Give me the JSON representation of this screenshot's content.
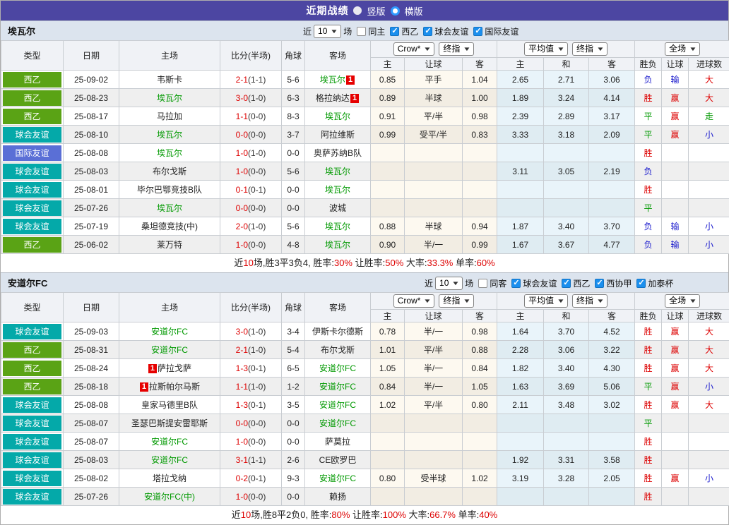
{
  "titlebar": {
    "title": "近期战绩",
    "radios": [
      {
        "label": "竖版",
        "checked": false
      },
      {
        "label": "横版",
        "checked": true
      }
    ]
  },
  "columns": [
    "类型",
    "日期",
    "主场",
    "比分(半场)",
    "角球",
    "客场",
    "主",
    "让球",
    "客",
    "主",
    "和",
    "客",
    "胜负",
    "让球",
    "进球数"
  ],
  "dropdowns": {
    "count": "10",
    "crow": "Crow*",
    "final_a": "终指",
    "avg": "平均值",
    "final_b": "终指",
    "full": "全场"
  },
  "filter_words": {
    "near": "近",
    "matches": "场"
  },
  "colors": {
    "accent_purple": "#4c46a2",
    "league_green": "#5aa315",
    "club_friendly_teal": "#04a9a9",
    "intl_friendly_blue": "#5a6fd6",
    "team_green": "#009900",
    "win_red": "#dd0000",
    "draw_green": "#009900",
    "loss_blue": "#1a1acd",
    "badge_red": "#e60000"
  },
  "sections": [
    {
      "team": "埃瓦尔",
      "checkboxes": [
        {
          "label": "同主",
          "checked": false
        },
        {
          "label": "西乙",
          "checked": true
        },
        {
          "label": "球会友谊",
          "checked": true
        },
        {
          "label": "国际友谊",
          "checked": true
        }
      ],
      "rows": [
        {
          "type": "西乙",
          "tc": "liga",
          "date": "25-09-02",
          "home": {
            "n": "韦斯卡"
          },
          "ft": "2-1",
          "ht": "(1-1)",
          "corner": "5-6",
          "away": {
            "n": "埃瓦尔",
            "g": 1,
            "badge": "1",
            "bpos": "after"
          },
          "crow": [
            "0.85",
            "平手",
            "1.04"
          ],
          "avg": [
            "2.65",
            "2.71",
            "3.06"
          ],
          "res": [
            [
              "负",
              "b"
            ],
            [
              "输",
              "b"
            ],
            [
              "大",
              "r"
            ]
          ]
        },
        {
          "type": "西乙",
          "tc": "liga",
          "date": "25-08-23",
          "home": {
            "n": "埃瓦尔",
            "g": 1
          },
          "ft": "3-0",
          "ht": "(1-0)",
          "corner": "6-3",
          "away": {
            "n": "格拉纳达",
            "badge": "1",
            "bpos": "after"
          },
          "crow": [
            "0.89",
            "半球",
            "1.00"
          ],
          "avg": [
            "1.89",
            "3.24",
            "4.14"
          ],
          "res": [
            [
              "胜",
              "r"
            ],
            [
              "赢",
              "r"
            ],
            [
              "大",
              "r"
            ]
          ]
        },
        {
          "type": "西乙",
          "tc": "liga",
          "date": "25-08-17",
          "home": {
            "n": "马拉加"
          },
          "ft": "1-1",
          "ht": "(0-0)",
          "corner": "8-3",
          "away": {
            "n": "埃瓦尔",
            "g": 1
          },
          "crow": [
            "0.91",
            "平/半",
            "0.98"
          ],
          "avg": [
            "2.39",
            "2.89",
            "3.17"
          ],
          "res": [
            [
              "平",
              "g"
            ],
            [
              "赢",
              "r"
            ],
            [
              "走",
              "g"
            ]
          ]
        },
        {
          "type": "球会友谊",
          "tc": "club",
          "date": "25-08-10",
          "home": {
            "n": "埃瓦尔",
            "g": 1
          },
          "ft": "0-0",
          "ht": "(0-0)",
          "corner": "3-7",
          "away": {
            "n": "阿拉维斯"
          },
          "crow": [
            "0.99",
            "受平/半",
            "0.83"
          ],
          "avg": [
            "3.33",
            "3.18",
            "2.09"
          ],
          "res": [
            [
              "平",
              "g"
            ],
            [
              "赢",
              "r"
            ],
            [
              "小",
              "b"
            ]
          ]
        },
        {
          "type": "国际友谊",
          "tc": "intl",
          "date": "25-08-08",
          "home": {
            "n": "埃瓦尔",
            "g": 1
          },
          "ft": "1-0",
          "ht": "(1-0)",
          "corner": "0-0",
          "away": {
            "n": "奥萨苏纳B队"
          },
          "crow": [
            "",
            "",
            ""
          ],
          "avg": [
            "",
            "",
            ""
          ],
          "res": [
            [
              "胜",
              "r"
            ],
            [
              "",
              ""
            ],
            [
              "",
              ""
            ]
          ]
        },
        {
          "type": "球会友谊",
          "tc": "club",
          "date": "25-08-03",
          "home": {
            "n": "布尔戈斯"
          },
          "ft": "1-0",
          "ht": "(0-0)",
          "corner": "5-6",
          "away": {
            "n": "埃瓦尔",
            "g": 1
          },
          "crow": [
            "",
            "",
            ""
          ],
          "avg": [
            "3.11",
            "3.05",
            "2.19"
          ],
          "res": [
            [
              "负",
              "b"
            ],
            [
              "",
              ""
            ],
            [
              "",
              ""
            ]
          ]
        },
        {
          "type": "球会友谊",
          "tc": "club",
          "date": "25-08-01",
          "home": {
            "n": "毕尔巴鄂竞技B队"
          },
          "ft": "0-1",
          "ht": "(0-1)",
          "corner": "0-0",
          "away": {
            "n": "埃瓦尔",
            "g": 1
          },
          "crow": [
            "",
            "",
            ""
          ],
          "avg": [
            "",
            "",
            ""
          ],
          "res": [
            [
              "胜",
              "r"
            ],
            [
              "",
              ""
            ],
            [
              "",
              ""
            ]
          ]
        },
        {
          "type": "球会友谊",
          "tc": "club",
          "date": "25-07-26",
          "home": {
            "n": "埃瓦尔",
            "g": 1
          },
          "ft": "0-0",
          "ht": "(0-0)",
          "corner": "0-0",
          "away": {
            "n": "波城"
          },
          "crow": [
            "",
            "",
            ""
          ],
          "avg": [
            "",
            "",
            ""
          ],
          "res": [
            [
              "平",
              "g"
            ],
            [
              "",
              ""
            ],
            [
              "",
              ""
            ]
          ]
        },
        {
          "type": "球会友谊",
          "tc": "club",
          "date": "25-07-19",
          "home": {
            "n": "桑坦德竞技(中)"
          },
          "ft": "2-0",
          "ht": "(1-0)",
          "corner": "5-6",
          "away": {
            "n": "埃瓦尔",
            "g": 1
          },
          "crow": [
            "0.88",
            "半球",
            "0.94"
          ],
          "avg": [
            "1.87",
            "3.40",
            "3.70"
          ],
          "res": [
            [
              "负",
              "b"
            ],
            [
              "输",
              "b"
            ],
            [
              "小",
              "b"
            ]
          ]
        },
        {
          "type": "西乙",
          "tc": "liga",
          "date": "25-06-02",
          "home": {
            "n": "莱万特"
          },
          "ft": "1-0",
          "ht": "(0-0)",
          "corner": "4-8",
          "away": {
            "n": "埃瓦尔",
            "g": 1
          },
          "crow": [
            "0.90",
            "半/一",
            "0.99"
          ],
          "avg": [
            "1.67",
            "3.67",
            "4.77"
          ],
          "res": [
            [
              "负",
              "b"
            ],
            [
              "输",
              "b"
            ],
            [
              "小",
              "b"
            ]
          ]
        }
      ],
      "summary": [
        [
          "近",
          0
        ],
        [
          "10",
          1
        ],
        [
          "场,胜3平3负4, 胜率:",
          0
        ],
        [
          "30%",
          1
        ],
        [
          " 让胜率:",
          0
        ],
        [
          "50%",
          1
        ],
        [
          " 大率:",
          0
        ],
        [
          "33.3%",
          1
        ],
        [
          " 单率:",
          0
        ],
        [
          "60%",
          1
        ]
      ]
    },
    {
      "team": "安道尔FC",
      "checkboxes": [
        {
          "label": "同客",
          "checked": false
        },
        {
          "label": "球会友谊",
          "checked": true
        },
        {
          "label": "西乙",
          "checked": true
        },
        {
          "label": "西协甲",
          "checked": true
        },
        {
          "label": "加泰杯",
          "checked": true
        }
      ],
      "rows": [
        {
          "type": "球会友谊",
          "tc": "club",
          "date": "25-09-03",
          "home": {
            "n": "安道尔FC",
            "g": 1
          },
          "ft": "3-0",
          "ht": "(1-0)",
          "corner": "3-4",
          "away": {
            "n": "伊斯卡尔德斯"
          },
          "crow": [
            "0.78",
            "半/一",
            "0.98"
          ],
          "avg": [
            "1.64",
            "3.70",
            "4.52"
          ],
          "res": [
            [
              "胜",
              "r"
            ],
            [
              "赢",
              "r"
            ],
            [
              "大",
              "r"
            ]
          ]
        },
        {
          "type": "西乙",
          "tc": "liga",
          "date": "25-08-31",
          "home": {
            "n": "安道尔FC",
            "g": 1
          },
          "ft": "2-1",
          "ht": "(1-0)",
          "corner": "5-4",
          "away": {
            "n": "布尔戈斯"
          },
          "crow": [
            "1.01",
            "平/半",
            "0.88"
          ],
          "avg": [
            "2.28",
            "3.06",
            "3.22"
          ],
          "res": [
            [
              "胜",
              "r"
            ],
            [
              "赢",
              "r"
            ],
            [
              "大",
              "r"
            ]
          ]
        },
        {
          "type": "西乙",
          "tc": "liga",
          "date": "25-08-24",
          "home": {
            "n": "萨拉戈萨",
            "badge": "1",
            "bpos": "before"
          },
          "ft": "1-3",
          "ht": "(0-1)",
          "corner": "6-5",
          "away": {
            "n": "安道尔FC",
            "g": 1
          },
          "crow": [
            "1.05",
            "半/一",
            "0.84"
          ],
          "avg": [
            "1.82",
            "3.40",
            "4.30"
          ],
          "res": [
            [
              "胜",
              "r"
            ],
            [
              "赢",
              "r"
            ],
            [
              "大",
              "r"
            ]
          ]
        },
        {
          "type": "西乙",
          "tc": "liga",
          "date": "25-08-18",
          "home": {
            "n": "拉斯帕尔马斯",
            "badge": "1",
            "bpos": "before"
          },
          "ft": "1-1",
          "ht": "(1-0)",
          "corner": "1-2",
          "away": {
            "n": "安道尔FC",
            "g": 1
          },
          "crow": [
            "0.84",
            "半/一",
            "1.05"
          ],
          "avg": [
            "1.63",
            "3.69",
            "5.06"
          ],
          "res": [
            [
              "平",
              "g"
            ],
            [
              "赢",
              "r"
            ],
            [
              "小",
              "b"
            ]
          ]
        },
        {
          "type": "球会友谊",
          "tc": "club",
          "date": "25-08-08",
          "home": {
            "n": "皇家马德里B队"
          },
          "ft": "1-3",
          "ht": "(0-1)",
          "corner": "3-5",
          "away": {
            "n": "安道尔FC",
            "g": 1
          },
          "crow": [
            "1.02",
            "平/半",
            "0.80"
          ],
          "avg": [
            "2.11",
            "3.48",
            "3.02"
          ],
          "res": [
            [
              "胜",
              "r"
            ],
            [
              "赢",
              "r"
            ],
            [
              "大",
              "r"
            ]
          ]
        },
        {
          "type": "球会友谊",
          "tc": "club",
          "date": "25-08-07",
          "home": {
            "n": "圣瑟巴斯提安雷耶斯"
          },
          "ft": "0-0",
          "ht": "(0-0)",
          "corner": "0-0",
          "away": {
            "n": "安道尔FC",
            "g": 1
          },
          "crow": [
            "",
            "",
            ""
          ],
          "avg": [
            "",
            "",
            ""
          ],
          "res": [
            [
              "平",
              "g"
            ],
            [
              "",
              ""
            ],
            [
              "",
              ""
            ]
          ]
        },
        {
          "type": "球会友谊",
          "tc": "club",
          "date": "25-08-07",
          "home": {
            "n": "安道尔FC",
            "g": 1
          },
          "ft": "1-0",
          "ht": "(0-0)",
          "corner": "0-0",
          "away": {
            "n": "萨莫拉"
          },
          "crow": [
            "",
            "",
            ""
          ],
          "avg": [
            "",
            "",
            ""
          ],
          "res": [
            [
              "胜",
              "r"
            ],
            [
              "",
              ""
            ],
            [
              "",
              ""
            ]
          ]
        },
        {
          "type": "球会友谊",
          "tc": "club",
          "date": "25-08-03",
          "home": {
            "n": "安道尔FC",
            "g": 1
          },
          "ft": "3-1",
          "ht": "(1-1)",
          "corner": "2-6",
          "away": {
            "n": "CE欧罗巴"
          },
          "crow": [
            "",
            "",
            ""
          ],
          "avg": [
            "1.92",
            "3.31",
            "3.58"
          ],
          "res": [
            [
              "胜",
              "r"
            ],
            [
              "",
              ""
            ],
            [
              "",
              ""
            ]
          ]
        },
        {
          "type": "球会友谊",
          "tc": "club",
          "date": "25-08-02",
          "home": {
            "n": "塔拉戈纳"
          },
          "ft": "0-2",
          "ht": "(0-1)",
          "corner": "9-3",
          "away": {
            "n": "安道尔FC",
            "g": 1
          },
          "crow": [
            "0.80",
            "受半球",
            "1.02"
          ],
          "avg": [
            "3.19",
            "3.28",
            "2.05"
          ],
          "res": [
            [
              "胜",
              "r"
            ],
            [
              "赢",
              "r"
            ],
            [
              "小",
              "b"
            ]
          ]
        },
        {
          "type": "球会友谊",
          "tc": "club",
          "date": "25-07-26",
          "home": {
            "n": "安道尔FC(中)",
            "g": 1
          },
          "ft": "1-0",
          "ht": "(0-0)",
          "corner": "0-0",
          "away": {
            "n": "赖扬"
          },
          "crow": [
            "",
            "",
            ""
          ],
          "avg": [
            "",
            "",
            ""
          ],
          "res": [
            [
              "胜",
              "r"
            ],
            [
              "",
              ""
            ],
            [
              "",
              ""
            ]
          ]
        }
      ],
      "summary": [
        [
          "近",
          0
        ],
        [
          "10",
          1
        ],
        [
          "场,胜8平2负0, 胜率:",
          0
        ],
        [
          "80%",
          1
        ],
        [
          " 让胜率:",
          0
        ],
        [
          "100%",
          1
        ],
        [
          " 大率:",
          0
        ],
        [
          "66.7%",
          1
        ],
        [
          " 单率:",
          0
        ],
        [
          "40%",
          1
        ]
      ]
    }
  ]
}
